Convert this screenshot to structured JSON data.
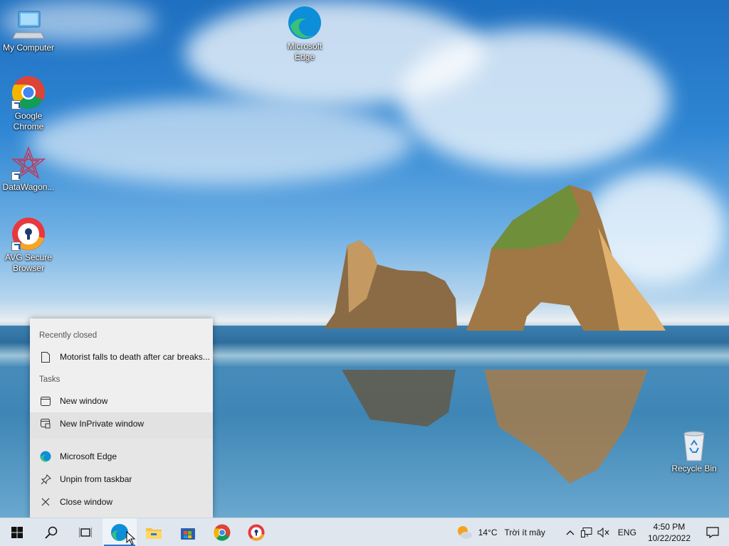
{
  "desktop": {
    "icons": [
      {
        "label": "My Computer",
        "icon": "computer-icon"
      },
      {
        "label": "Google Chrome",
        "icon": "chrome-icon"
      },
      {
        "label": "DataWagon...",
        "icon": "datawagon-icon"
      },
      {
        "label": "AVG Secure Browser",
        "icon": "avg-browser-icon"
      },
      {
        "label": "Microsoft Edge",
        "icon": "edge-icon"
      },
      {
        "label": "Recycle Bin",
        "icon": "recycle-bin-icon"
      }
    ]
  },
  "jumplist": {
    "recently_closed_header": "Recently closed",
    "recent_item": "Motorist falls to death after car breaks...",
    "tasks_header": "Tasks",
    "tasks": [
      "New window",
      "New InPrivate window"
    ],
    "app_name": "Microsoft Edge",
    "unpin": "Unpin from taskbar",
    "close": "Close window"
  },
  "taskbar": {
    "apps": [
      "start-icon",
      "search-icon",
      "task-view-icon",
      "edge-icon",
      "file-explorer-icon",
      "store-icon",
      "chrome-icon",
      "avg-browser-icon"
    ],
    "weather_temp": "14°C",
    "weather_text": "Trời ít mây",
    "language": "ENG",
    "time": "4:50 PM",
    "date": "10/22/2022"
  },
  "colors": {
    "accent": "#2b78d6",
    "taskbar": "#dfe6ee",
    "menu": "#efefef"
  }
}
